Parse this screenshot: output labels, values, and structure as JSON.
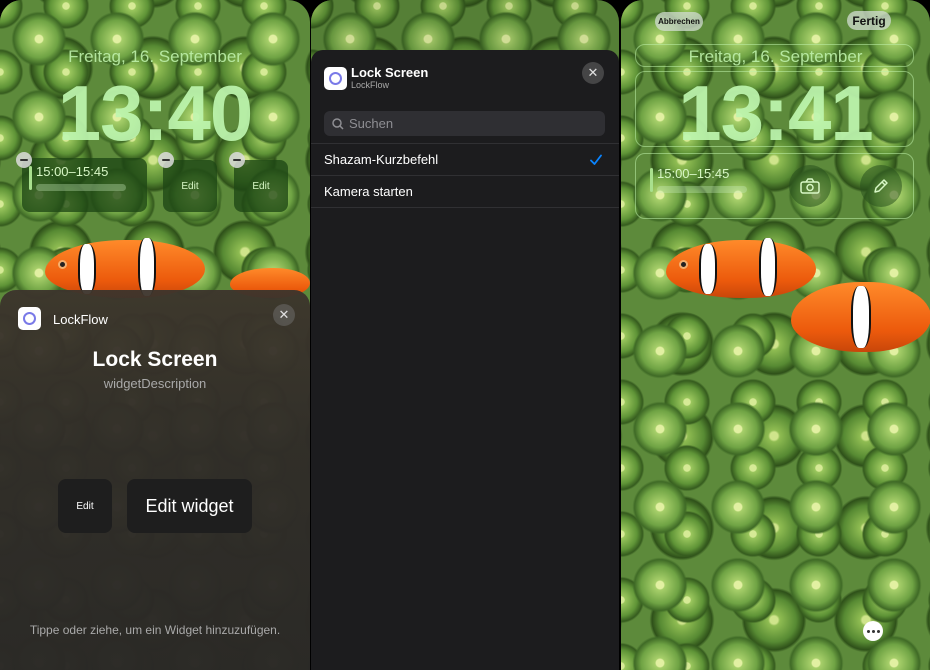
{
  "panel1": {
    "date": "Freitag, 16. September",
    "time": "13:40",
    "calendar_widget_time": "15:00–15:45",
    "small_widget_1_label": "Edit",
    "small_widget_2_label": "Edit",
    "sheet": {
      "app_name": "LockFlow",
      "title": "Lock Screen",
      "subtitle": "widgetDescription",
      "small_preview_label": "Edit",
      "large_preview_label": "Edit widget",
      "hint": "Tippe oder ziehe, um ein Widget hinzuzufügen."
    }
  },
  "panel2": {
    "title": "Lock Screen",
    "app_name": "LockFlow",
    "search_placeholder": "Suchen",
    "items": [
      {
        "label": "Shazam-Kurzbefehl",
        "selected": true
      },
      {
        "label": "Kamera starten",
        "selected": false
      }
    ],
    "check_color": "#0a84ff"
  },
  "panel3": {
    "cancel_label": "Abbrechen",
    "done_label": "Fertig",
    "date": "Freitag, 16. September",
    "time": "13:41",
    "calendar_widget_time": "15:00–15:45",
    "camera_widget_icon": "camera-icon",
    "pen_widget_icon": "pen-icon"
  }
}
